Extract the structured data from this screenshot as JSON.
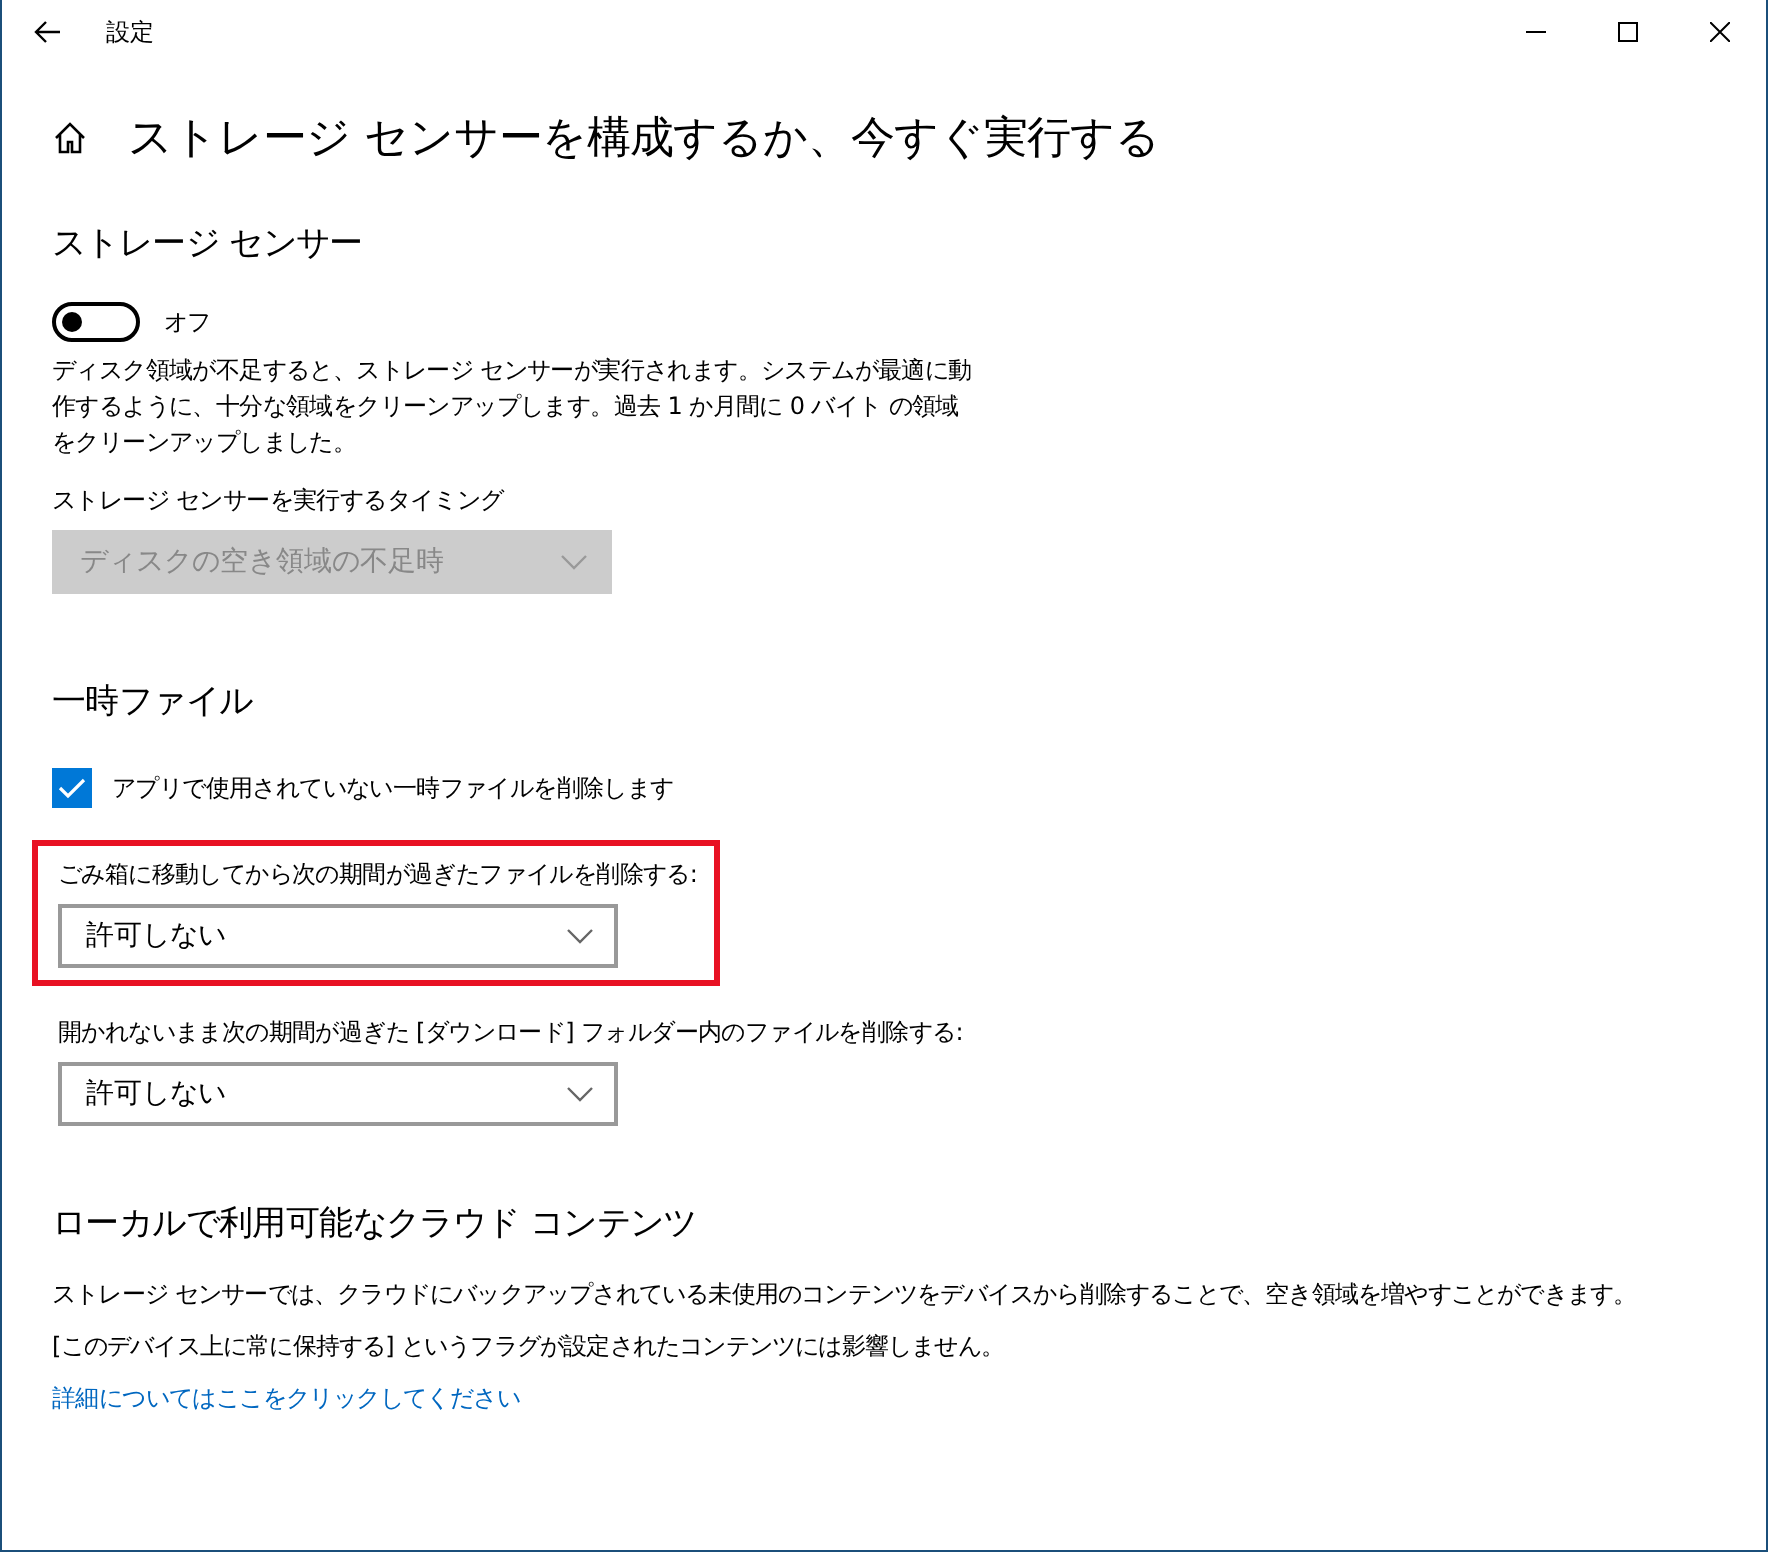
{
  "window": {
    "title": "設定"
  },
  "page": {
    "title": "ストレージ センサーを構成するか、今すぐ実行する"
  },
  "storage_sense": {
    "heading": "ストレージ センサー",
    "toggle": {
      "on": false,
      "label": "オフ"
    },
    "description": "ディスク領域が不足すると、ストレージ センサーが実行されます。システムが最適に動作するように、十分な領域をクリーンアップします。過去 1 か月間に 0 バイト の領域をクリーンアップしました。",
    "timing": {
      "label": "ストレージ センサーを実行するタイミング",
      "value": "ディスクの空き領域の不足時",
      "disabled": true
    }
  },
  "temp_files": {
    "heading": "一時ファイル",
    "checkbox": {
      "label": "アプリで使用されていない一時ファイルを削除します",
      "checked": true
    },
    "settings": [
      {
        "label": "ごみ箱に移動してから次の期間が過ぎたファイルを削除する:",
        "value": "許可しない",
        "highlighted": true
      },
      {
        "label": "開かれないまま次の期間が過ぎた [ダウンロード] フォルダー内のファイルを削除する:",
        "value": "許可しない",
        "highlighted": false
      }
    ]
  },
  "cloud": {
    "heading": "ローカルで利用可能なクラウド コンテンツ",
    "paragraphs": [
      "ストレージ センサーでは、クラウドにバックアップされている未使用のコンテンツをデバイスから削除することで、空き領域を増やすことができます。",
      "[このデバイス上に常に保持する] というフラグが設定されたコンテンツには影響しません。"
    ],
    "link": "詳細についてはここをクリックしてください"
  }
}
